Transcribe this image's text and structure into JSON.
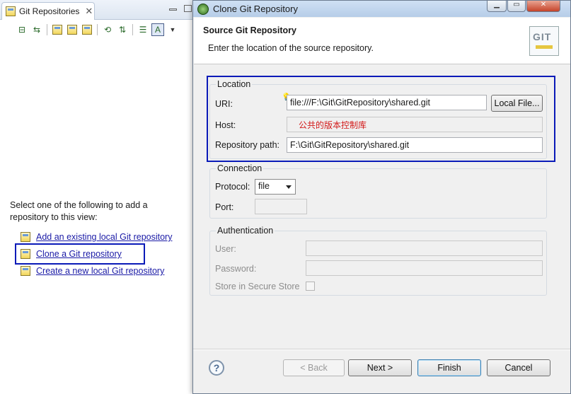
{
  "view": {
    "tab_title": "Git Repositories",
    "intro_text": "Select one of the following to add a repository to this view:",
    "links": [
      {
        "label": "Add an existing local Git repository"
      },
      {
        "label": "Clone a Git repository"
      },
      {
        "label": "Create a new local Git repository"
      }
    ]
  },
  "dialog": {
    "window_title": "Clone Git Repository",
    "header_title": "Source Git Repository",
    "header_description": "Enter the location of the source repository.",
    "logo_text": "GIT",
    "location": {
      "legend": "Location",
      "uri_label": "URI:",
      "uri_value": "file:///F:\\Git\\GitRepository\\shared.git",
      "local_file_button": "Local File...",
      "host_label": "Host:",
      "host_annotation": "公共的版本控制库",
      "repo_path_label": "Repository path:",
      "repo_path_value": "F:\\Git\\GitRepository\\shared.git"
    },
    "connection": {
      "legend": "Connection",
      "protocol_label": "Protocol:",
      "protocol_value": "file",
      "port_label": "Port:"
    },
    "authentication": {
      "legend": "Authentication",
      "user_label": "User:",
      "password_label": "Password:",
      "secure_store_label": "Store in Secure Store"
    },
    "buttons": {
      "help": "?",
      "back": "< Back",
      "next": "Next >",
      "finish": "Finish",
      "cancel": "Cancel"
    }
  },
  "colors": {
    "highlight_border": "#0a1ab8",
    "annotation_text": "#d21818",
    "link_text": "#1a1aa6"
  }
}
